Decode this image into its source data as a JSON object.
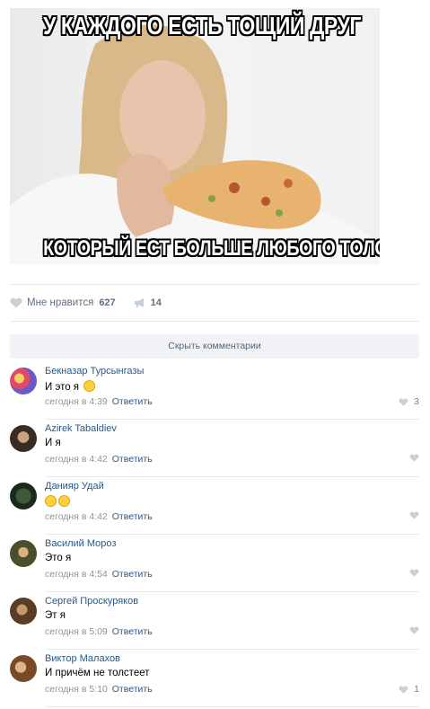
{
  "post": {
    "meme_top": "У каждого есть тощий друг",
    "meme_bottom": "Который ест больше любого толстяка"
  },
  "actions": {
    "like_label": "Мне нравится",
    "like_count": "627",
    "share_count": "14"
  },
  "hide_comments_label": "Скрыть комментарии",
  "comments": [
    {
      "author": "Бекназар Турсынгазы",
      "text": "И это я",
      "time": "сегодня в 4:39",
      "reply": "Ответить",
      "likes": "3"
    },
    {
      "author": "Azirek Tabaldiev",
      "text": "И я",
      "time": "сегодня в 4:42",
      "reply": "Ответить",
      "likes": ""
    },
    {
      "author": "Данияр Удай",
      "text": "",
      "time": "сегодня в 4:42",
      "reply": "Ответить",
      "likes": ""
    },
    {
      "author": "Василий Мороз",
      "text": "Это я",
      "time": "сегодня в 4:54",
      "reply": "Ответить",
      "likes": ""
    },
    {
      "author": "Сергей Проскуряков",
      "text": "Эт я",
      "time": "сегодня в 5:09",
      "reply": "Ответить",
      "likes": ""
    },
    {
      "author": "Виктор Малахов",
      "text": "И причём не толстеет",
      "time": "сегодня в 5:10",
      "reply": "Ответить",
      "likes": "1"
    }
  ],
  "icons": {
    "like": "heart-icon",
    "share": "megaphone-icon",
    "emoji": "laughing-face-emoji"
  },
  "colors": {
    "link": "#2a5885",
    "muted": "#939393",
    "button_bg": "#f0f2f5"
  }
}
